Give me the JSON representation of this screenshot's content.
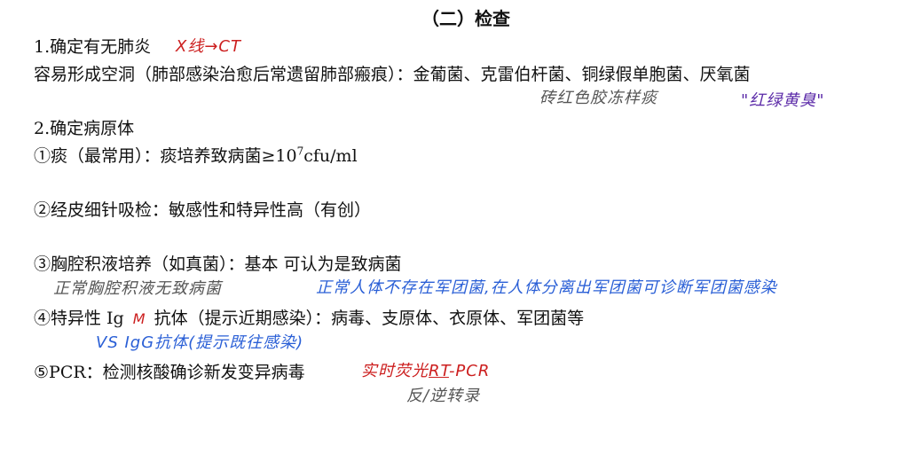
{
  "title": "（二）检查",
  "s1": {
    "heading": "1.确定有无肺炎",
    "note": "X线→CT",
    "line2": "容易形成空洞（肺部感染治愈后常遗留肺部瘢痕）：金葡菌、克雷伯杆菌、铜绿假单胞菌、厌氧菌",
    "note_sputum": "砖红色胶冻样痰",
    "note_colors": "\"红绿黄臭\""
  },
  "s2": {
    "heading": "2.确定病原体",
    "item1_pre": "①痰（最常用）：痰培养致病菌≥10",
    "item1_sup": "7",
    "item1_post": "cfu/ml",
    "item2": "②经皮细针吸检：敏感性和特异性高（有创）",
    "item3": "③胸腔积液培养（如真菌）：基本 可认为是致病菌",
    "item3_note_left": "正常胸腔积液无致病菌",
    "item3_note_right": "正常人体不存在军团菌,在人体分离出军团菌可诊断军团菌感染",
    "item4_pre": "④特异性 Ig",
    "item4_m": "M",
    "item4_post": "抗体（提示近期感染）：病毒、支原体、衣原体、军团菌等",
    "item4_note": "VS IgG抗体(提示既往感染)",
    "item5": "⑤PCR：检测核酸确诊新发变异病毒",
    "item5_note_a": "实时荧光",
    "item5_note_rt": "RT",
    "item5_note_b": "-PCR",
    "item5_note_below": "反/逆转录"
  }
}
